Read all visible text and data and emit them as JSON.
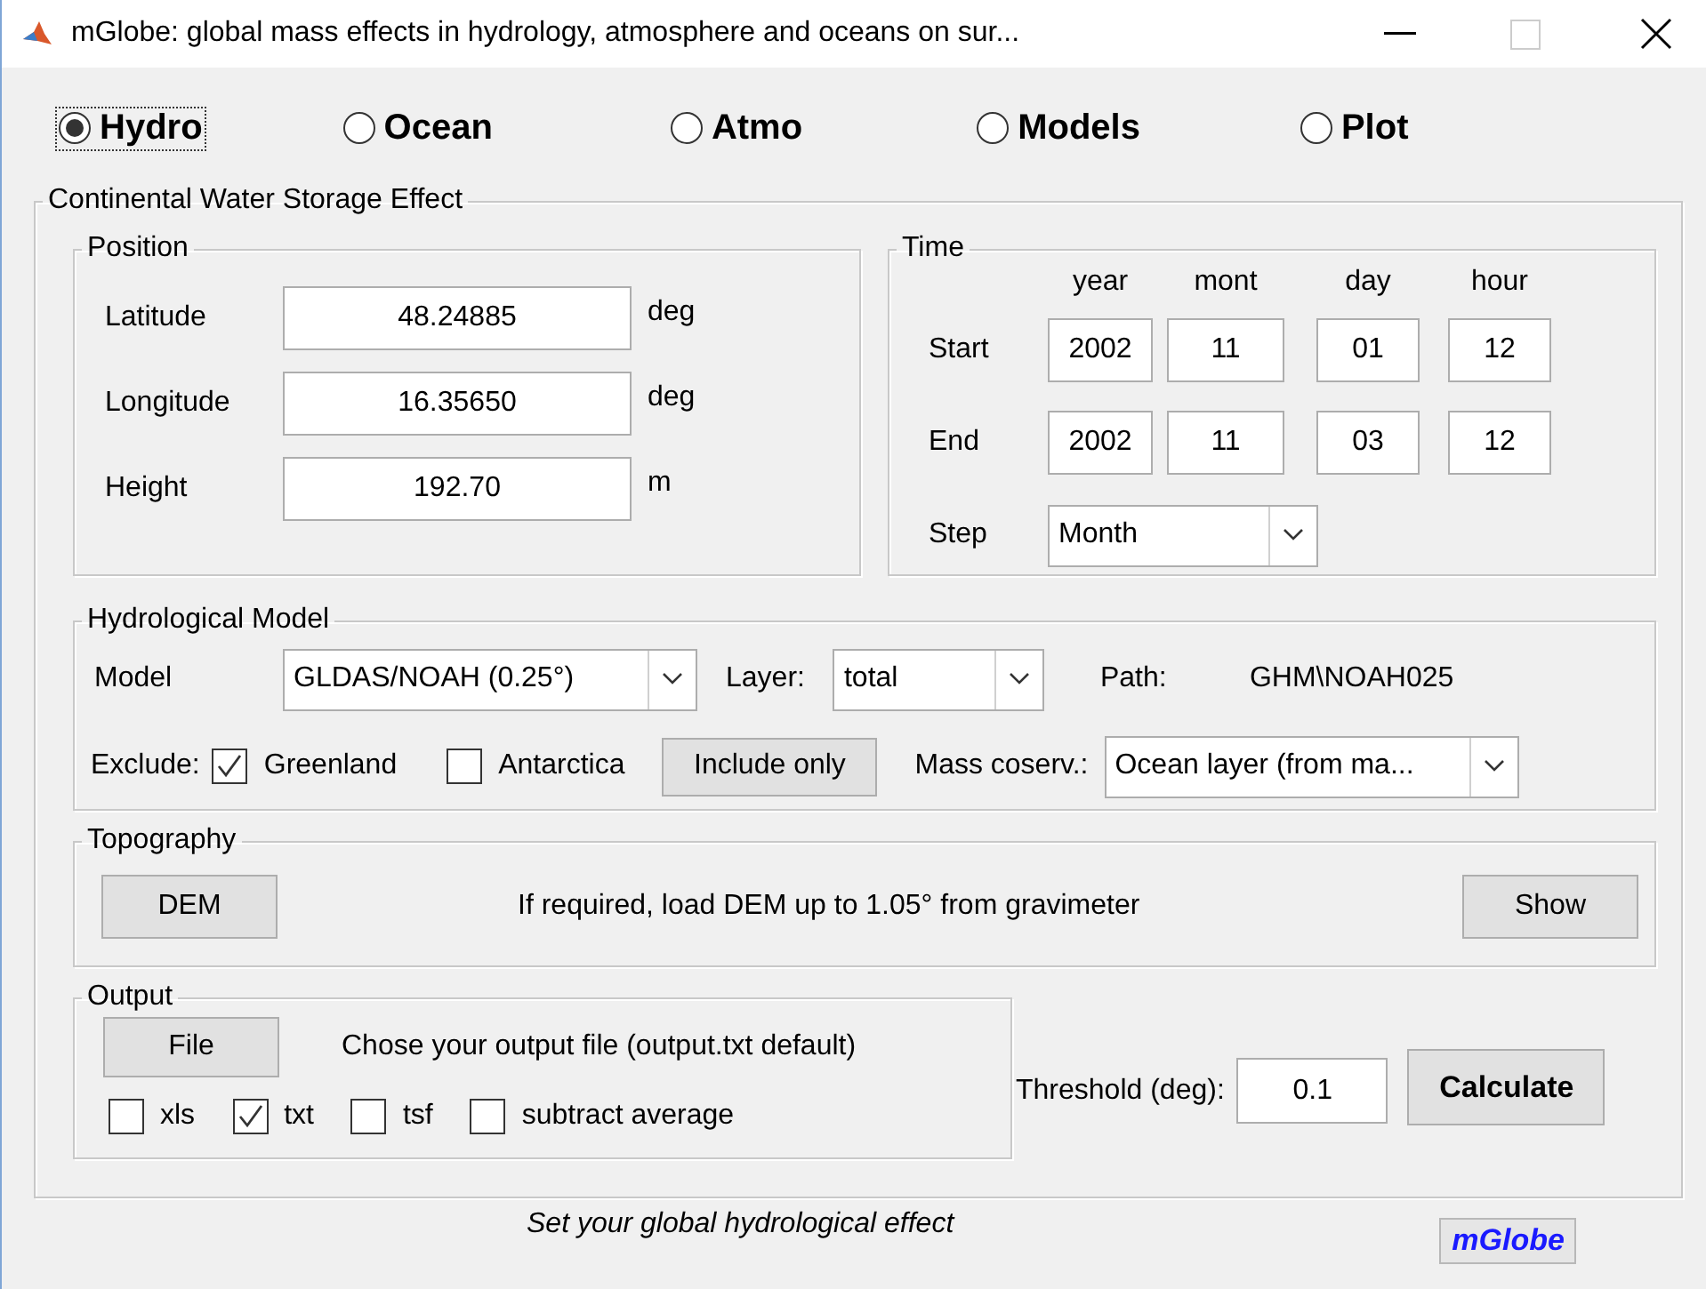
{
  "window": {
    "title": "mGlobe: global mass effects in hydrology, atmosphere and oceans on sur..."
  },
  "modes": [
    {
      "label": "Hydro",
      "selected": true
    },
    {
      "label": "Ocean",
      "selected": false
    },
    {
      "label": "Atmo",
      "selected": false
    },
    {
      "label": "Models",
      "selected": false
    },
    {
      "label": "Plot",
      "selected": false
    }
  ],
  "panel": {
    "title": "Continental Water Storage Effect",
    "position": {
      "title": "Position",
      "fields": [
        {
          "label": "Latitude",
          "value": "48.24885",
          "unit": "deg"
        },
        {
          "label": "Longitude",
          "value": "16.35650",
          "unit": "deg"
        },
        {
          "label": "Height",
          "value": "192.70",
          "unit": "m"
        }
      ]
    },
    "time": {
      "title": "Time",
      "columns": [
        "year",
        "mont",
        "day",
        "hour"
      ],
      "rows": [
        {
          "label": "Start",
          "values": [
            "2002",
            "11",
            "01",
            "12"
          ]
        },
        {
          "label": "End",
          "values": [
            "2002",
            "11",
            "03",
            "12"
          ]
        }
      ],
      "step": {
        "label": "Step",
        "value": "Month"
      }
    },
    "hydrological_model": {
      "title": "Hydrological Model",
      "model": {
        "label": "Model",
        "value": "GLDAS/NOAH (0.25°)"
      },
      "layer": {
        "label": "Layer:",
        "value": "total"
      },
      "path": {
        "label": "Path:",
        "value": "GHM\\NOAH025"
      },
      "exclude": {
        "label": "Exclude:",
        "options": [
          {
            "label": "Greenland",
            "checked": true
          },
          {
            "label": "Antarctica",
            "checked": false
          }
        ]
      },
      "include_button": "Include only",
      "mass_conservation": {
        "label": "Mass coserv.:",
        "value": "Ocean layer (from ma..."
      }
    },
    "topography": {
      "title": "Topography",
      "button": "DEM",
      "note": "If required, load DEM up to 1.05° from gravimeter",
      "show_button": "Show"
    },
    "output": {
      "title": "Output",
      "button": "File",
      "note": "Chose your output file (output.txt default)",
      "formats": [
        {
          "label": "xls",
          "checked": false
        },
        {
          "label": "txt",
          "checked": true
        },
        {
          "label": "tsf",
          "checked": false
        },
        {
          "label": "subtract average",
          "checked": false
        }
      ]
    },
    "threshold": {
      "label": "Threshold (deg):",
      "value": "0.1"
    },
    "calculate_button": "Calculate"
  },
  "status": "Set your global hydrological effect",
  "brand": "mGlobe"
}
